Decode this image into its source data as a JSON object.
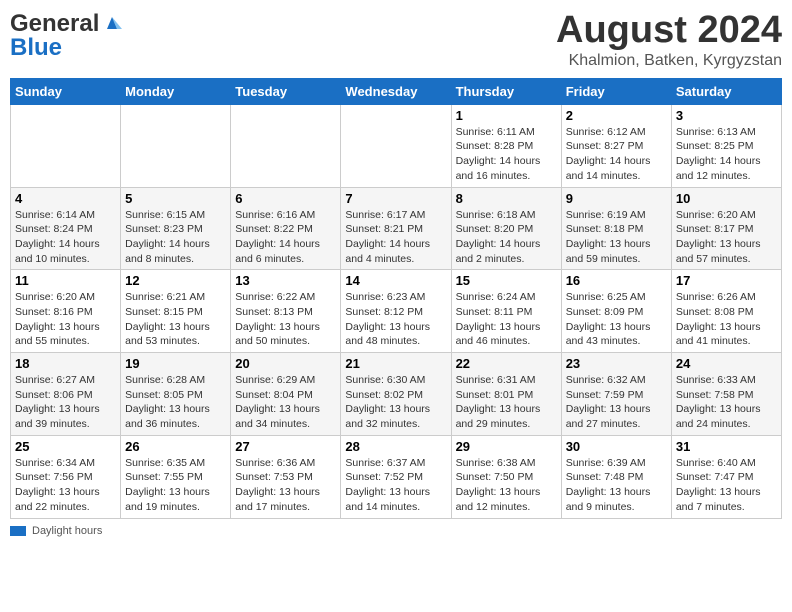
{
  "header": {
    "logo_general": "General",
    "logo_blue": "Blue",
    "month_title": "August 2024",
    "location": "Khalmion, Batken, Kyrgyzstan"
  },
  "days_of_week": [
    "Sunday",
    "Monday",
    "Tuesday",
    "Wednesday",
    "Thursday",
    "Friday",
    "Saturday"
  ],
  "weeks": [
    {
      "days": [
        {
          "number": "",
          "info": ""
        },
        {
          "number": "",
          "info": ""
        },
        {
          "number": "",
          "info": ""
        },
        {
          "number": "",
          "info": ""
        },
        {
          "number": "1",
          "info": "Sunrise: 6:11 AM\nSunset: 8:28 PM\nDaylight: 14 hours and 16 minutes."
        },
        {
          "number": "2",
          "info": "Sunrise: 6:12 AM\nSunset: 8:27 PM\nDaylight: 14 hours and 14 minutes."
        },
        {
          "number": "3",
          "info": "Sunrise: 6:13 AM\nSunset: 8:25 PM\nDaylight: 14 hours and 12 minutes."
        }
      ]
    },
    {
      "days": [
        {
          "number": "4",
          "info": "Sunrise: 6:14 AM\nSunset: 8:24 PM\nDaylight: 14 hours and 10 minutes."
        },
        {
          "number": "5",
          "info": "Sunrise: 6:15 AM\nSunset: 8:23 PM\nDaylight: 14 hours and 8 minutes."
        },
        {
          "number": "6",
          "info": "Sunrise: 6:16 AM\nSunset: 8:22 PM\nDaylight: 14 hours and 6 minutes."
        },
        {
          "number": "7",
          "info": "Sunrise: 6:17 AM\nSunset: 8:21 PM\nDaylight: 14 hours and 4 minutes."
        },
        {
          "number": "8",
          "info": "Sunrise: 6:18 AM\nSunset: 8:20 PM\nDaylight: 14 hours and 2 minutes."
        },
        {
          "number": "9",
          "info": "Sunrise: 6:19 AM\nSunset: 8:18 PM\nDaylight: 13 hours and 59 minutes."
        },
        {
          "number": "10",
          "info": "Sunrise: 6:20 AM\nSunset: 8:17 PM\nDaylight: 13 hours and 57 minutes."
        }
      ]
    },
    {
      "days": [
        {
          "number": "11",
          "info": "Sunrise: 6:20 AM\nSunset: 8:16 PM\nDaylight: 13 hours and 55 minutes."
        },
        {
          "number": "12",
          "info": "Sunrise: 6:21 AM\nSunset: 8:15 PM\nDaylight: 13 hours and 53 minutes."
        },
        {
          "number": "13",
          "info": "Sunrise: 6:22 AM\nSunset: 8:13 PM\nDaylight: 13 hours and 50 minutes."
        },
        {
          "number": "14",
          "info": "Sunrise: 6:23 AM\nSunset: 8:12 PM\nDaylight: 13 hours and 48 minutes."
        },
        {
          "number": "15",
          "info": "Sunrise: 6:24 AM\nSunset: 8:11 PM\nDaylight: 13 hours and 46 minutes."
        },
        {
          "number": "16",
          "info": "Sunrise: 6:25 AM\nSunset: 8:09 PM\nDaylight: 13 hours and 43 minutes."
        },
        {
          "number": "17",
          "info": "Sunrise: 6:26 AM\nSunset: 8:08 PM\nDaylight: 13 hours and 41 minutes."
        }
      ]
    },
    {
      "days": [
        {
          "number": "18",
          "info": "Sunrise: 6:27 AM\nSunset: 8:06 PM\nDaylight: 13 hours and 39 minutes."
        },
        {
          "number": "19",
          "info": "Sunrise: 6:28 AM\nSunset: 8:05 PM\nDaylight: 13 hours and 36 minutes."
        },
        {
          "number": "20",
          "info": "Sunrise: 6:29 AM\nSunset: 8:04 PM\nDaylight: 13 hours and 34 minutes."
        },
        {
          "number": "21",
          "info": "Sunrise: 6:30 AM\nSunset: 8:02 PM\nDaylight: 13 hours and 32 minutes."
        },
        {
          "number": "22",
          "info": "Sunrise: 6:31 AM\nSunset: 8:01 PM\nDaylight: 13 hours and 29 minutes."
        },
        {
          "number": "23",
          "info": "Sunrise: 6:32 AM\nSunset: 7:59 PM\nDaylight: 13 hours and 27 minutes."
        },
        {
          "number": "24",
          "info": "Sunrise: 6:33 AM\nSunset: 7:58 PM\nDaylight: 13 hours and 24 minutes."
        }
      ]
    },
    {
      "days": [
        {
          "number": "25",
          "info": "Sunrise: 6:34 AM\nSunset: 7:56 PM\nDaylight: 13 hours and 22 minutes."
        },
        {
          "number": "26",
          "info": "Sunrise: 6:35 AM\nSunset: 7:55 PM\nDaylight: 13 hours and 19 minutes."
        },
        {
          "number": "27",
          "info": "Sunrise: 6:36 AM\nSunset: 7:53 PM\nDaylight: 13 hours and 17 minutes."
        },
        {
          "number": "28",
          "info": "Sunrise: 6:37 AM\nSunset: 7:52 PM\nDaylight: 13 hours and 14 minutes."
        },
        {
          "number": "29",
          "info": "Sunrise: 6:38 AM\nSunset: 7:50 PM\nDaylight: 13 hours and 12 minutes."
        },
        {
          "number": "30",
          "info": "Sunrise: 6:39 AM\nSunset: 7:48 PM\nDaylight: 13 hours and 9 minutes."
        },
        {
          "number": "31",
          "info": "Sunrise: 6:40 AM\nSunset: 7:47 PM\nDaylight: 13 hours and 7 minutes."
        }
      ]
    }
  ],
  "footer": {
    "daylight_label": "Daylight hours"
  }
}
